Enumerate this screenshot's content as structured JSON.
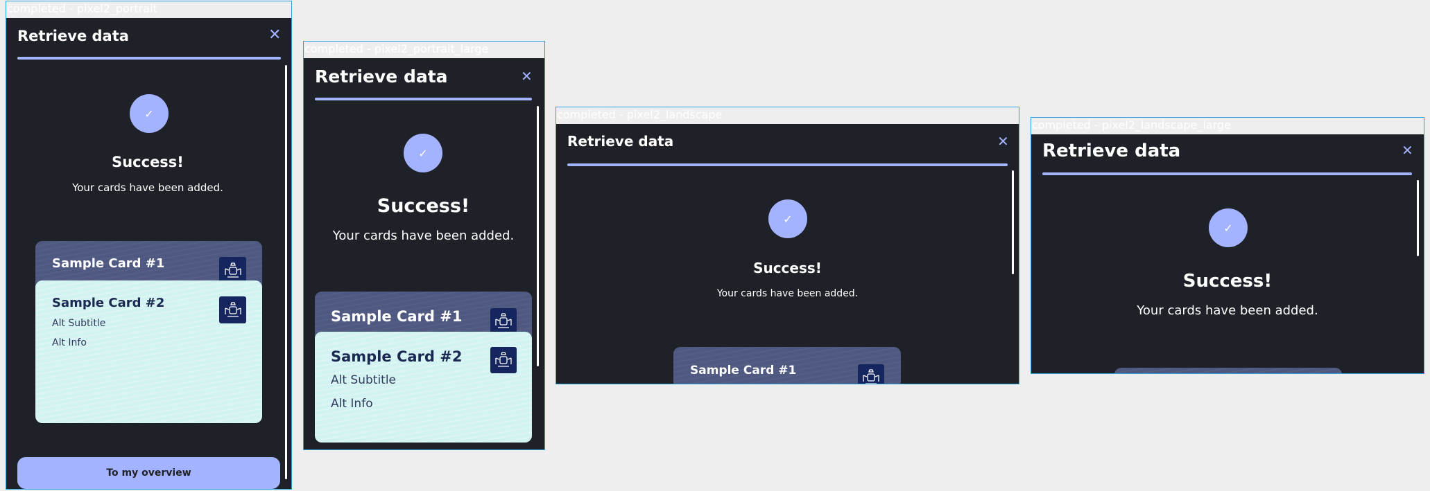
{
  "frames": [
    {
      "label": "completed - pixel2_portrait"
    },
    {
      "label": "completed - pixel2_portrait_large"
    },
    {
      "label": "completed - pixel2_landscape"
    },
    {
      "label": "completed - pixel2_landscape_large"
    }
  ],
  "screen": {
    "title": "Retrieve data",
    "close_icon": "close-icon",
    "check_icon": "checkmark-icon",
    "heading": "Success!",
    "message": "Your cards have been added.",
    "cards": [
      {
        "title": "Sample Card #1",
        "emblem": "coat-of-arms-icon"
      },
      {
        "title": "Sample Card #2",
        "subtitle": "Alt Subtitle",
        "info": "Alt Info",
        "emblem": "coat-of-arms-icon"
      }
    ],
    "primary_button": "To my overview"
  },
  "colors": {
    "background": "#1f2128",
    "accent": "#a4b3ff",
    "card_dark": "#4e5880",
    "card_light": "#d2f3f1",
    "emblem": "#14265d",
    "frame_border": "#2aa0dc",
    "canvas": "#eeeeee"
  }
}
